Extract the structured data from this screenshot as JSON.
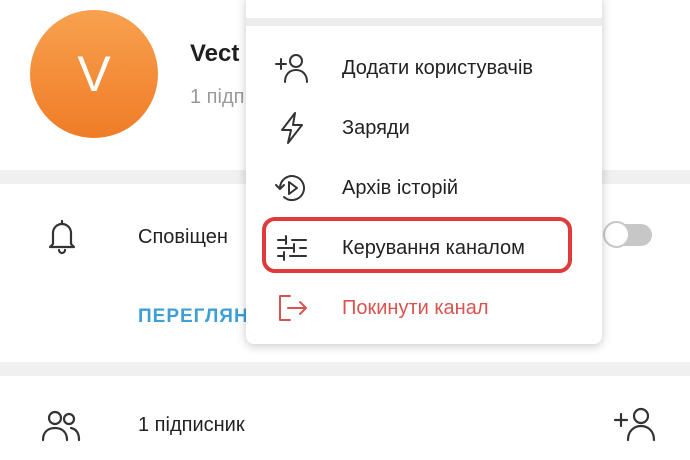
{
  "channel": {
    "avatar_letter": "V",
    "name": "Vect",
    "subscribers_short": "1 підп"
  },
  "notifications": {
    "label": "Сповіщен",
    "view_link": "ПЕРЕГЛЯН",
    "toggle_on": false
  },
  "members_row": {
    "label": "1 підписник",
    "icon": "add-user-icon"
  },
  "menu": {
    "items": [
      {
        "label": "Додати користувачів",
        "icon": "add-user-icon"
      },
      {
        "label": "Заряди",
        "icon": "lightning-icon"
      },
      {
        "label": "Архів історій",
        "icon": "story-archive-icon"
      },
      {
        "label": "Керування каналом",
        "icon": "sliders-icon",
        "highlighted": true
      },
      {
        "label": "Покинути канал",
        "icon": "leave-icon",
        "danger": true
      }
    ]
  },
  "colors": {
    "avatar": "#f58a35",
    "link": "#3d9fd6",
    "danger": "#d9534f",
    "highlight": "#e03a3a"
  }
}
